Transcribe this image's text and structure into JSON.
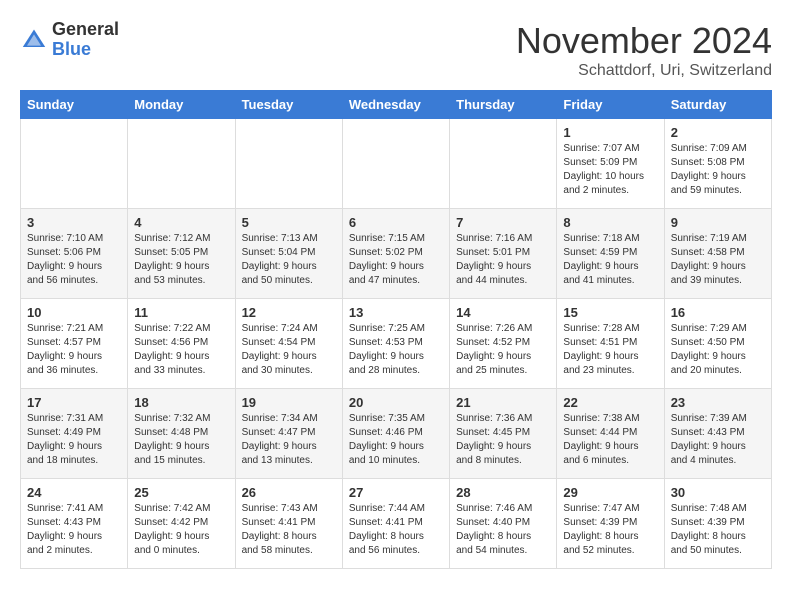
{
  "logo": {
    "general": "General",
    "blue": "Blue"
  },
  "header": {
    "month": "November 2024",
    "location": "Schattdorf, Uri, Switzerland"
  },
  "weekdays": [
    "Sunday",
    "Monday",
    "Tuesday",
    "Wednesday",
    "Thursday",
    "Friday",
    "Saturday"
  ],
  "weeks": [
    [
      {
        "day": "",
        "info": ""
      },
      {
        "day": "",
        "info": ""
      },
      {
        "day": "",
        "info": ""
      },
      {
        "day": "",
        "info": ""
      },
      {
        "day": "",
        "info": ""
      },
      {
        "day": "1",
        "info": "Sunrise: 7:07 AM\nSunset: 5:09 PM\nDaylight: 10 hours\nand 2 minutes."
      },
      {
        "day": "2",
        "info": "Sunrise: 7:09 AM\nSunset: 5:08 PM\nDaylight: 9 hours\nand 59 minutes."
      }
    ],
    [
      {
        "day": "3",
        "info": "Sunrise: 7:10 AM\nSunset: 5:06 PM\nDaylight: 9 hours\nand 56 minutes."
      },
      {
        "day": "4",
        "info": "Sunrise: 7:12 AM\nSunset: 5:05 PM\nDaylight: 9 hours\nand 53 minutes."
      },
      {
        "day": "5",
        "info": "Sunrise: 7:13 AM\nSunset: 5:04 PM\nDaylight: 9 hours\nand 50 minutes."
      },
      {
        "day": "6",
        "info": "Sunrise: 7:15 AM\nSunset: 5:02 PM\nDaylight: 9 hours\nand 47 minutes."
      },
      {
        "day": "7",
        "info": "Sunrise: 7:16 AM\nSunset: 5:01 PM\nDaylight: 9 hours\nand 44 minutes."
      },
      {
        "day": "8",
        "info": "Sunrise: 7:18 AM\nSunset: 4:59 PM\nDaylight: 9 hours\nand 41 minutes."
      },
      {
        "day": "9",
        "info": "Sunrise: 7:19 AM\nSunset: 4:58 PM\nDaylight: 9 hours\nand 39 minutes."
      }
    ],
    [
      {
        "day": "10",
        "info": "Sunrise: 7:21 AM\nSunset: 4:57 PM\nDaylight: 9 hours\nand 36 minutes."
      },
      {
        "day": "11",
        "info": "Sunrise: 7:22 AM\nSunset: 4:56 PM\nDaylight: 9 hours\nand 33 minutes."
      },
      {
        "day": "12",
        "info": "Sunrise: 7:24 AM\nSunset: 4:54 PM\nDaylight: 9 hours\nand 30 minutes."
      },
      {
        "day": "13",
        "info": "Sunrise: 7:25 AM\nSunset: 4:53 PM\nDaylight: 9 hours\nand 28 minutes."
      },
      {
        "day": "14",
        "info": "Sunrise: 7:26 AM\nSunset: 4:52 PM\nDaylight: 9 hours\nand 25 minutes."
      },
      {
        "day": "15",
        "info": "Sunrise: 7:28 AM\nSunset: 4:51 PM\nDaylight: 9 hours\nand 23 minutes."
      },
      {
        "day": "16",
        "info": "Sunrise: 7:29 AM\nSunset: 4:50 PM\nDaylight: 9 hours\nand 20 minutes."
      }
    ],
    [
      {
        "day": "17",
        "info": "Sunrise: 7:31 AM\nSunset: 4:49 PM\nDaylight: 9 hours\nand 18 minutes."
      },
      {
        "day": "18",
        "info": "Sunrise: 7:32 AM\nSunset: 4:48 PM\nDaylight: 9 hours\nand 15 minutes."
      },
      {
        "day": "19",
        "info": "Sunrise: 7:34 AM\nSunset: 4:47 PM\nDaylight: 9 hours\nand 13 minutes."
      },
      {
        "day": "20",
        "info": "Sunrise: 7:35 AM\nSunset: 4:46 PM\nDaylight: 9 hours\nand 10 minutes."
      },
      {
        "day": "21",
        "info": "Sunrise: 7:36 AM\nSunset: 4:45 PM\nDaylight: 9 hours\nand 8 minutes."
      },
      {
        "day": "22",
        "info": "Sunrise: 7:38 AM\nSunset: 4:44 PM\nDaylight: 9 hours\nand 6 minutes."
      },
      {
        "day": "23",
        "info": "Sunrise: 7:39 AM\nSunset: 4:43 PM\nDaylight: 9 hours\nand 4 minutes."
      }
    ],
    [
      {
        "day": "24",
        "info": "Sunrise: 7:41 AM\nSunset: 4:43 PM\nDaylight: 9 hours\nand 2 minutes."
      },
      {
        "day": "25",
        "info": "Sunrise: 7:42 AM\nSunset: 4:42 PM\nDaylight: 9 hours\nand 0 minutes."
      },
      {
        "day": "26",
        "info": "Sunrise: 7:43 AM\nSunset: 4:41 PM\nDaylight: 8 hours\nand 58 minutes."
      },
      {
        "day": "27",
        "info": "Sunrise: 7:44 AM\nSunset: 4:41 PM\nDaylight: 8 hours\nand 56 minutes."
      },
      {
        "day": "28",
        "info": "Sunrise: 7:46 AM\nSunset: 4:40 PM\nDaylight: 8 hours\nand 54 minutes."
      },
      {
        "day": "29",
        "info": "Sunrise: 7:47 AM\nSunset: 4:39 PM\nDaylight: 8 hours\nand 52 minutes."
      },
      {
        "day": "30",
        "info": "Sunrise: 7:48 AM\nSunset: 4:39 PM\nDaylight: 8 hours\nand 50 minutes."
      }
    ]
  ]
}
